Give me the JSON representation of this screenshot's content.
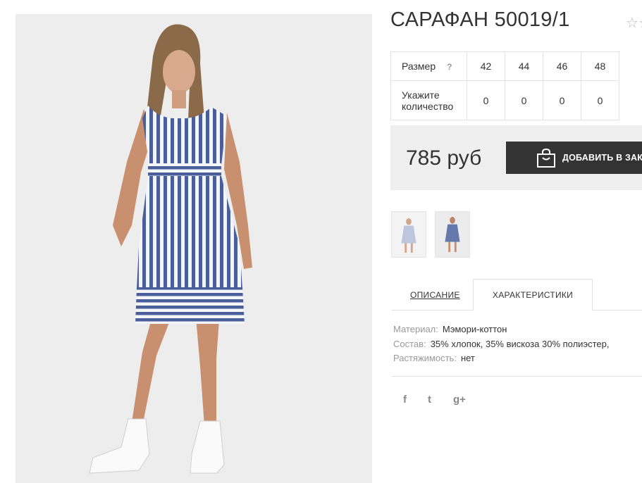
{
  "product": {
    "title": "САРАФАН 50019/1",
    "wishlist_icon": "star-outline-icon",
    "wishlist_glyph": "☆☆"
  },
  "sizes": {
    "size_label": "Размер",
    "hint": "?",
    "values": [
      "42",
      "44",
      "46",
      "48"
    ],
    "quantity_label": "Укажите количество",
    "quantities": [
      "0",
      "0",
      "0",
      "0"
    ]
  },
  "price": {
    "amount": "785 руб",
    "cart_button": "ДОБАВИТЬ В ЗАКАЗ",
    "cart_icon": "shopping-bag-icon"
  },
  "thumbnails": [
    {
      "name": "front-view"
    },
    {
      "name": "full-view"
    }
  ],
  "tabs": {
    "description": "ОПИСАНИЕ",
    "characteristics": "ХАРАКТЕРИСТИКИ",
    "active": "characteristics"
  },
  "specs": [
    {
      "key": "Материал:",
      "value": "Мэмори-коттон"
    },
    {
      "key": "Состав:",
      "value": "35% хлопок, 35% вискоза 30% полиэстер,"
    },
    {
      "key": "Растяжимость:",
      "value": "нет"
    }
  ],
  "social": [
    {
      "icon": "facebook-icon",
      "glyph": "f"
    },
    {
      "icon": "twitter-icon",
      "glyph": "t"
    },
    {
      "icon": "google-plus-icon",
      "glyph": "g+"
    }
  ],
  "colors": {
    "stripe": "#4a5f9a",
    "button": "#333333",
    "price_bg": "#efefef"
  }
}
